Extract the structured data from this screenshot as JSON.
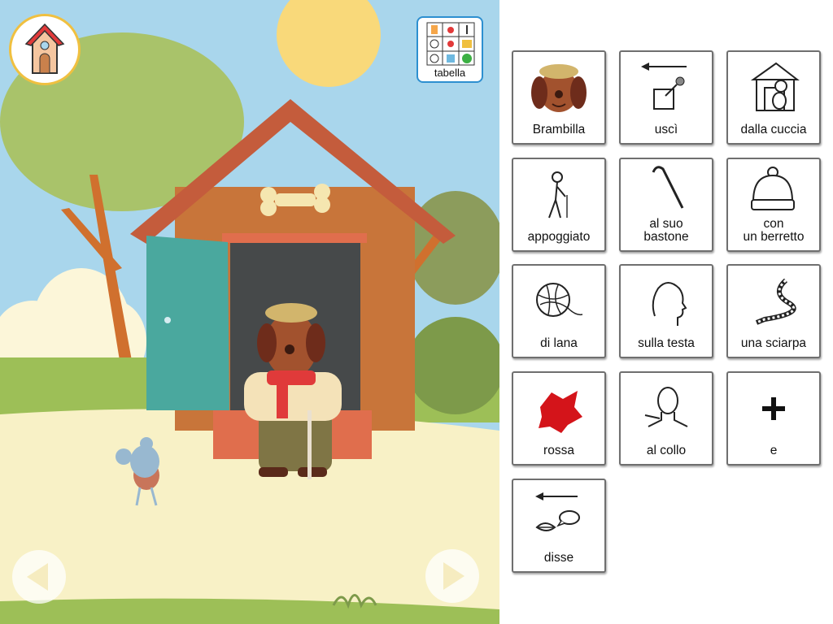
{
  "toolbar": {
    "home_icon": "doghouse-home-icon",
    "tabella_label": "tabella",
    "tabella_icon": "symbol-grid-icon",
    "prev_icon": "arrow-left-icon",
    "next_icon": "arrow-right-icon"
  },
  "scene": {
    "characters": [
      "dog-brambilla",
      "mouse"
    ],
    "colors": {
      "sky": "#a9d6ec",
      "sun": "#f9d97a",
      "ground": "#f8f1c6",
      "house": "#c8753a",
      "roof": "#c45c3c",
      "door": "#4aa89e"
    }
  },
  "board": {
    "cards": [
      {
        "label": "Brambilla",
        "icon": "dog-face-icon"
      },
      {
        "label": "uscì",
        "icon": "exit-arrow-icon"
      },
      {
        "label": "dalla cuccia",
        "icon": "dog-in-kennel-icon"
      },
      {
        "label": "appoggiato",
        "icon": "person-with-cane-icon"
      },
      {
        "label": "al suo\nbastone",
        "icon": "cane-icon"
      },
      {
        "label": "con\nun berretto",
        "icon": "beanie-hat-icon"
      },
      {
        "label": "di lana",
        "icon": "yarn-ball-icon"
      },
      {
        "label": "sulla testa",
        "icon": "head-profile-icon"
      },
      {
        "label": "una sciarpa",
        "icon": "scarf-icon"
      },
      {
        "label": "rossa",
        "icon": "red-color-icon"
      },
      {
        "label": "al collo",
        "icon": "neck-icon"
      },
      {
        "label": "e",
        "icon": "plus-icon"
      },
      {
        "label": "disse",
        "icon": "speak-icon"
      }
    ]
  }
}
